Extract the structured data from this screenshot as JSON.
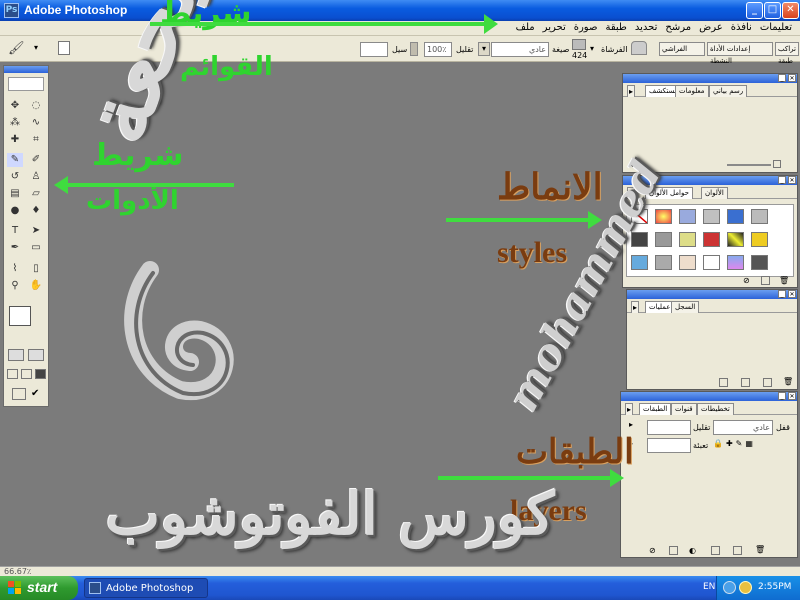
{
  "window": {
    "title": "Adobe Photoshop"
  },
  "menu": [
    "ملف",
    "تحرير",
    "صورة",
    "طبقة",
    "تحديد",
    "مرشح",
    "عرض",
    "نافذة",
    "تعليمات"
  ],
  "options_bar": {
    "mode_select": "عادي",
    "mode_label": "صيغة",
    "opacity_label": "تقليل",
    "opacity_value": "100٪",
    "flow_label": "سيل",
    "brush_size": "424",
    "airbrush_label": "الفرشاة",
    "palette_tabs": [
      "تراكب طبقة",
      "إعدادات الأداة النشطة",
      "الفراشي"
    ]
  },
  "palettes": {
    "navigator": {
      "tabs": [
        "مستكشف",
        "معلومات",
        "رسم بياني"
      ]
    },
    "styles": {
      "tabs": [
        "حوامل الألوان",
        "الألوان"
      ]
    },
    "history": {
      "tabs": [
        "عمليات",
        "السجل"
      ]
    },
    "layers": {
      "tabs": [
        "الطبقات",
        "قنوات",
        "تخطيطات"
      ],
      "blend_mode": "عادي",
      "opacity_label": "تقليل",
      "lock_label": "قفل",
      "fill_label": "تعبئة"
    }
  },
  "overlay_labels": {
    "menu_bar": "شريط",
    "menu_bar_2": "القوائم",
    "tool_bar": "شريط",
    "tool_bar_2": "الأدوات",
    "styles_ar": "الانماط",
    "styles_en": "styles",
    "layers_ar": "الطبقات",
    "layers_en": "layers",
    "course_title": "كورس الفوتوشوب",
    "watermark_ar": "منتدى بحعة",
    "signature": "mohammed"
  },
  "status_bar": {
    "zoom": "66.67٪"
  },
  "taskbar": {
    "start_label": "start",
    "task_label": "Adobe Photoshop",
    "lang": "EN",
    "clock": "2:55PM"
  },
  "colors": {
    "title_bar": "#0a5ce0",
    "workspace": "#7b7b7b",
    "arrow_green": "#3fdc3f",
    "taskbar": "#245edb",
    "start_green": "#2f9a2f"
  }
}
